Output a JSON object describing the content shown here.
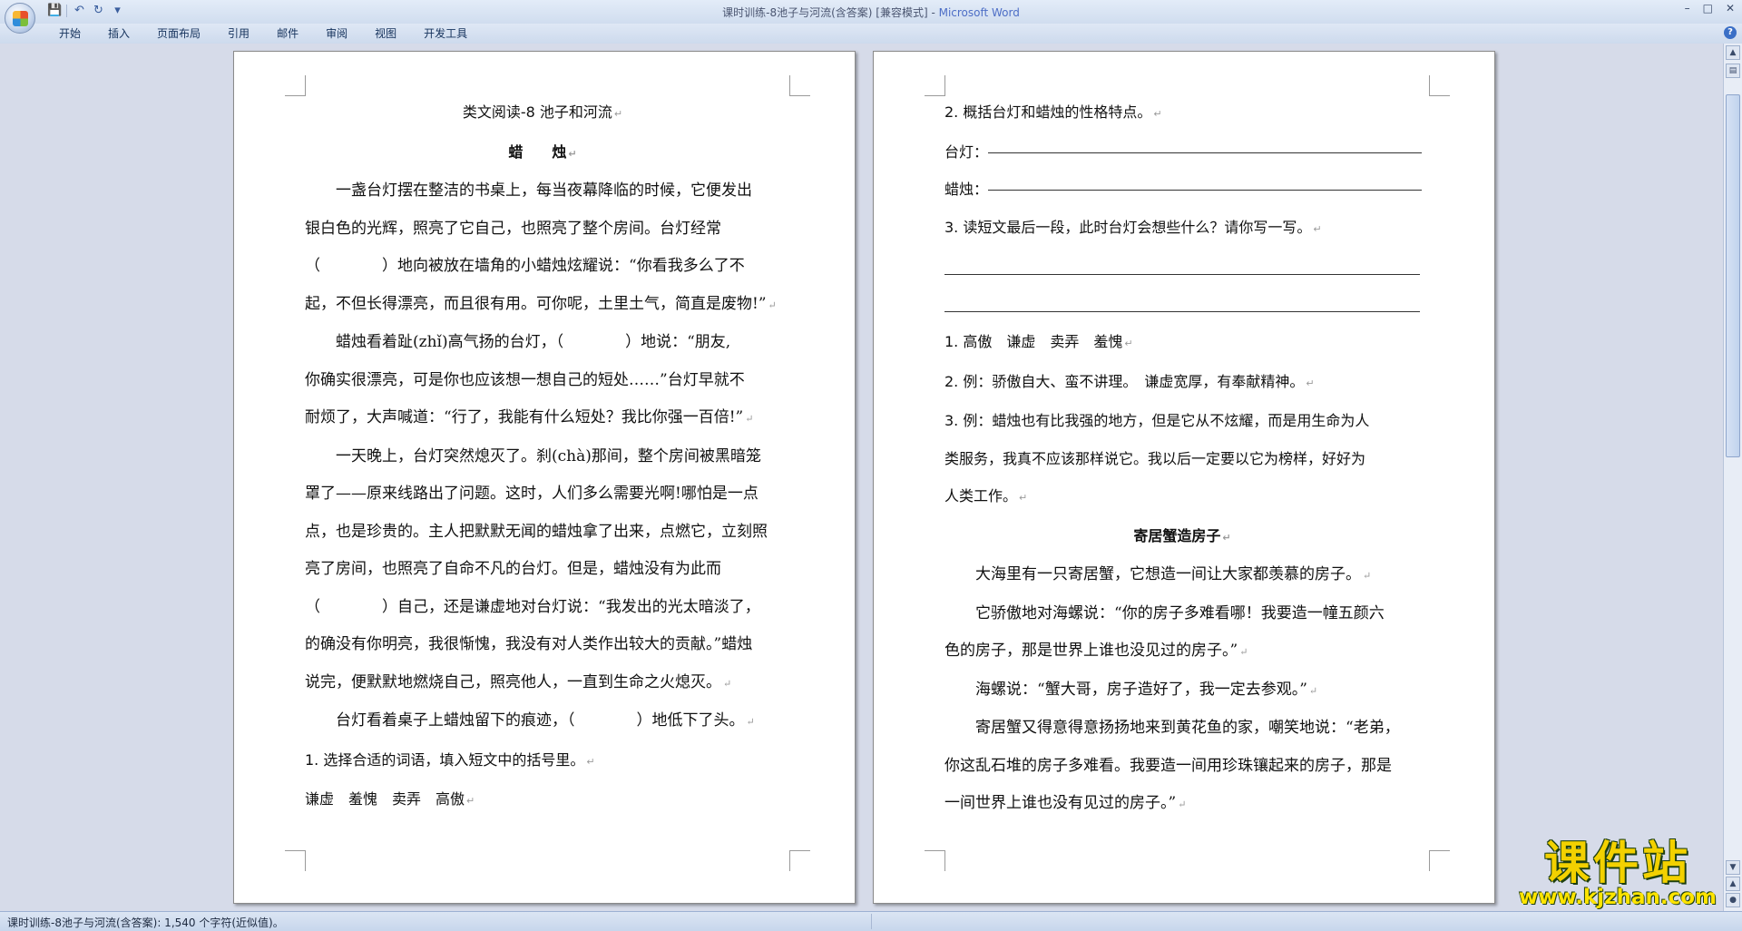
{
  "window": {
    "title_doc": "课时训练-8池子与河流(含答案) [兼容模式] - ",
    "title_app": "Microsoft Word",
    "controls": [
      "–",
      "□",
      "✕"
    ]
  },
  "quick_access": {
    "save_icon": "💾",
    "undo_icon": "↶",
    "redo_icon": "↻",
    "more_icon": "▾"
  },
  "ribbon": {
    "tabs": [
      "开始",
      "插入",
      "页面布局",
      "引用",
      "邮件",
      "审阅",
      "视图",
      "开发工具"
    ],
    "help": "?"
  },
  "left_page": {
    "title": "类文阅读-8 池子和河流",
    "subtitle": "蜡　　烛",
    "lines": [
      "一盏台灯摆在整洁的书桌上，每当夜幕降临的时候，它便发出",
      "银白色的光辉，照亮了它自己，也照亮了整个房间。台灯经常",
      "（　　　　）地向被放在墙角的小蜡烛炫耀说：“你看我多么了不",
      "起，不但长得漂亮，而且很有用。可你呢，土里土气，简直是废物!”",
      "蜡烛看着趾(zhǐ)高气扬的台灯，（　　　　）地说：“朋友,",
      "你确实很漂亮，可是你也应该想一想自己的短处……”台灯早就不",
      "耐烦了，大声喊道：“行了，我能有什么短处？我比你强一百倍!”",
      "一天晚上，台灯突然熄灭了。刹(chà)那间，整个房间被黑暗笼",
      "罩了——原来线路出了问题。这时，人们多么需要光啊!哪怕是一点",
      "点，也是珍贵的。主人把默默无闻的蜡烛拿了出来，点燃它，立刻照",
      "亮了房间，也照亮了自命不凡的台灯。但是，蜡烛没有为此而",
      "（　　　　）自己，还是谦虚地对台灯说：“我发出的光太暗淡了，",
      "的确没有你明亮，我很惭愧，我没有对人类作出较大的贡献。”蜡烛",
      "说完，便默默地燃烧自己，照亮他人，一直到生命之火熄灭。",
      "台灯看着桌子上蜡烛留下的痕迹，（　　　　）地低下了头。",
      "1. 选择合适的词语，填入短文中的括号里。",
      "谦虚　羞愧　卖弄　高傲"
    ]
  },
  "right_page": {
    "q2": "2. 概括台灯和蜡烛的性格特点。",
    "q2_a_label": "台灯：",
    "q2_b_label": "蜡烛：",
    "q3": "3. 读短文最后一段，此时台灯会想些什么？请你写一写。",
    "ans1": "1. 高傲　谦虚　卖弄　羞愧",
    "ans2": "2. 例：骄傲自大、蛮不讲理。　谦虚宽厚，有奉献精神。",
    "ans3_lines": [
      "3. 例：蜡烛也有比我强的地方，但是它从不炫耀，而是用生命为人",
      "类服务，我真不应该那样说它。我以后一定要以它为榜样，好好为",
      "人类工作。"
    ],
    "story2_title": "寄居蟹造房子",
    "story2_lines": [
      "大海里有一只寄居蟹，它想造一间让大家都羡慕的房子。",
      "它骄傲地对海螺说：“你的房子多难看哪！我要造一幢五颜六",
      "色的房子，那是世界上谁也没见过的房子。”",
      "海螺说：“蟹大哥，房子造好了，我一定去参观。”",
      "寄居蟹又得意得意扬扬地来到黄花鱼的家，嘲笑地说：“老弟，",
      "你这乱石堆的房子多难看。我要造一间用珍珠镶起来的房子，那是",
      "一间世界上谁也没有见过的房子。”"
    ]
  },
  "paragraph_mark": "↵",
  "status": {
    "text": "课时训练-8池子与河流(含答案): 1,540 个字符(近似值)。"
  },
  "watermark": {
    "cn": "课件站",
    "url": "www.kjzhan.com"
  }
}
